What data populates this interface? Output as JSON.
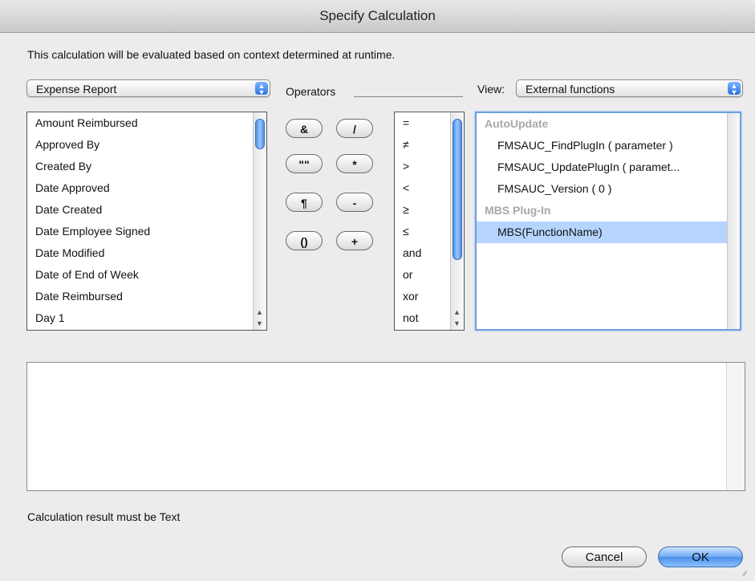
{
  "window": {
    "title": "Specify Calculation"
  },
  "description": "This calculation will be evaluated based on context determined at runtime.",
  "table_popup": {
    "selected": "Expense Report"
  },
  "operators": {
    "label": "Operators",
    "buttons": [
      "&",
      "/",
      "\"\"",
      "*",
      "¶",
      "-",
      "()",
      "+"
    ],
    "list": [
      "=",
      "≠",
      ">",
      "<",
      "≥",
      "≤",
      "and",
      "or",
      "xor",
      "not"
    ]
  },
  "view": {
    "label": "View:",
    "selected": "External functions"
  },
  "fields": [
    "Amount Reimbursed",
    "Approved By",
    "Created By",
    "Date Approved",
    "Date Created",
    "Date Employee Signed",
    "Date Modified",
    "Date of End of Week",
    "Date Reimbursed",
    "Day 1"
  ],
  "functions": {
    "groups": [
      {
        "name": "AutoUpdate",
        "items": [
          "FMSAUC_FindPlugIn ( parameter )",
          "FMSAUC_UpdatePlugIn ( paramet...",
          "FMSAUC_Version ( 0 )"
        ]
      },
      {
        "name": "MBS Plug-In",
        "items": [
          "MBS(FunctionName)"
        ]
      }
    ],
    "selected": "MBS(FunctionName)"
  },
  "result_note": "Calculation result must be Text",
  "buttons": {
    "cancel": "Cancel",
    "ok": "OK"
  },
  "colors": {
    "accent": "#4b8fe8",
    "selection": "#b5d5ff",
    "group_header": "#a8a8a8"
  },
  "icons": {
    "popup_arrows": "updown-arrows-icon",
    "resize": "resize-grip-icon"
  }
}
